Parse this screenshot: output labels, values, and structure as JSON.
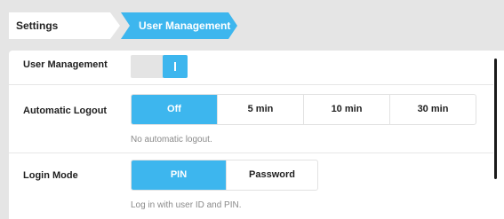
{
  "breadcrumb": {
    "items": [
      "Settings",
      "User Management"
    ]
  },
  "colors": {
    "accent": "#3db6ee",
    "background": "#e5e5e5",
    "panel": "#ffffff"
  },
  "settings": {
    "user_management": {
      "label": "User Management",
      "enabled": true
    },
    "automatic_logout": {
      "label": "Automatic Logout",
      "options": [
        "Off",
        "5 min",
        "10 min",
        "30 min"
      ],
      "selected": "Off",
      "description": "No automatic logout."
    },
    "login_mode": {
      "label": "Login Mode",
      "options": [
        "PIN",
        "Password"
      ],
      "selected": "PIN",
      "description": "Log in with user ID and PIN."
    }
  }
}
